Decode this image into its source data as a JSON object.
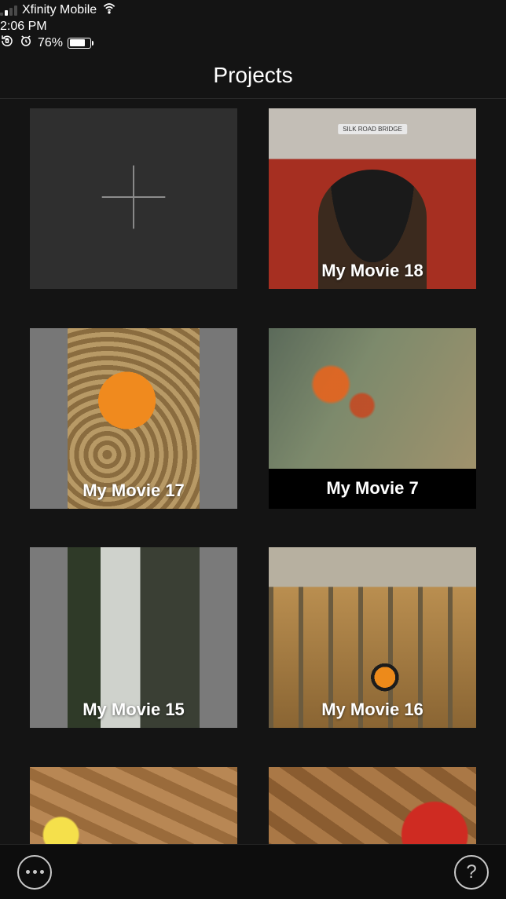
{
  "status_bar": {
    "carrier": "Xfinity Mobile",
    "time": "2:06 PM",
    "battery_percent": "76%"
  },
  "header": {
    "title": "Projects"
  },
  "projects": [
    {
      "title": "My Movie 18"
    },
    {
      "title": "My Movie 17"
    },
    {
      "title": "My Movie 7"
    },
    {
      "title": "My Movie 15"
    },
    {
      "title": "My Movie 16"
    }
  ]
}
